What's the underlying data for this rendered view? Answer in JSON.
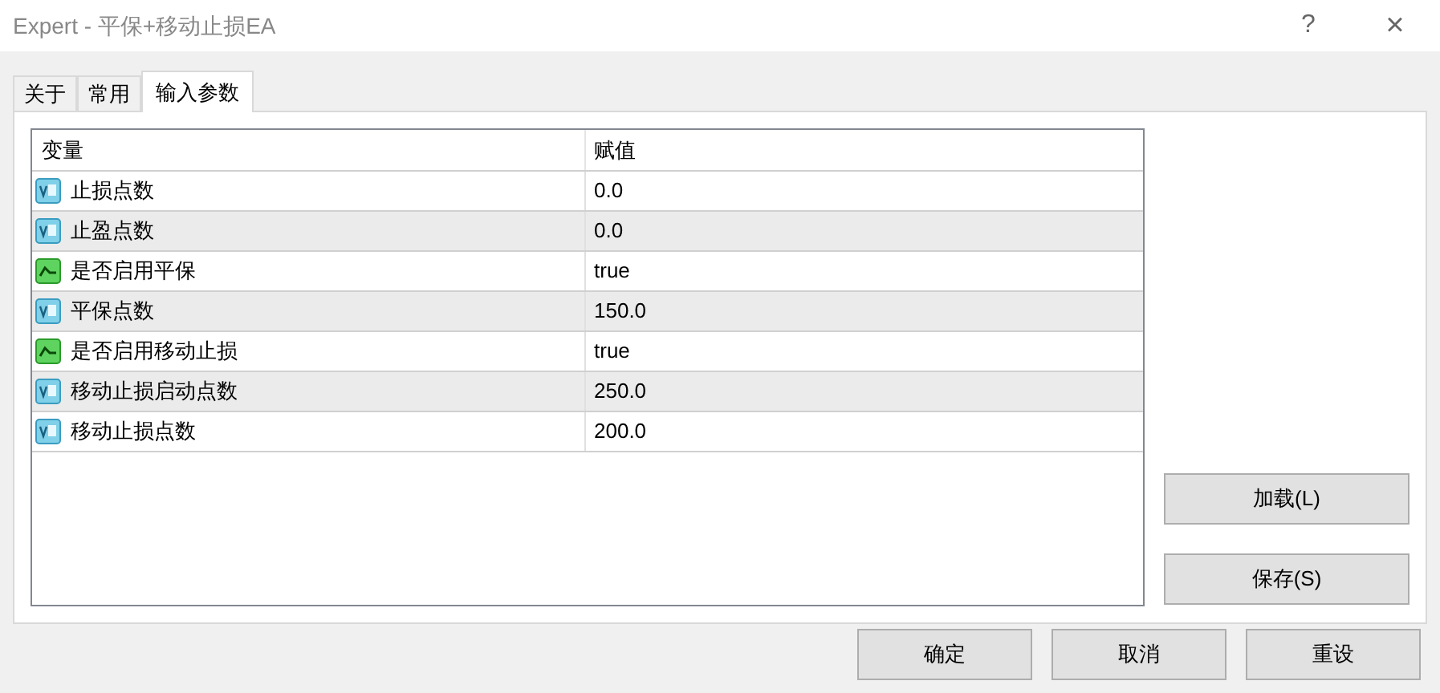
{
  "window": {
    "title": "Expert - 平保+移动止损EA",
    "help": "?",
    "close": "×"
  },
  "tabs": [
    {
      "label": "关于",
      "selected": false
    },
    {
      "label": "常用",
      "selected": false
    },
    {
      "label": "输入参数",
      "selected": true
    }
  ],
  "table": {
    "columns": [
      "变量",
      "赋值"
    ],
    "rows": [
      {
        "kind": "number",
        "name": "止损点数",
        "value": "0.0"
      },
      {
        "kind": "number",
        "name": "止盈点数",
        "value": "0.0"
      },
      {
        "kind": "bool",
        "name": "是否启用平保",
        "value": "true"
      },
      {
        "kind": "number",
        "name": "平保点数",
        "value": "150.0"
      },
      {
        "kind": "bool",
        "name": "是否启用移动止损",
        "value": "true"
      },
      {
        "kind": "number",
        "name": "移动止损启动点数",
        "value": "250.0"
      },
      {
        "kind": "number",
        "name": "移动止损点数",
        "value": "200.0"
      }
    ]
  },
  "side_buttons": [
    "加载(L)",
    "保存(S)"
  ],
  "buttons": [
    "确定",
    "取消",
    "重设"
  ]
}
